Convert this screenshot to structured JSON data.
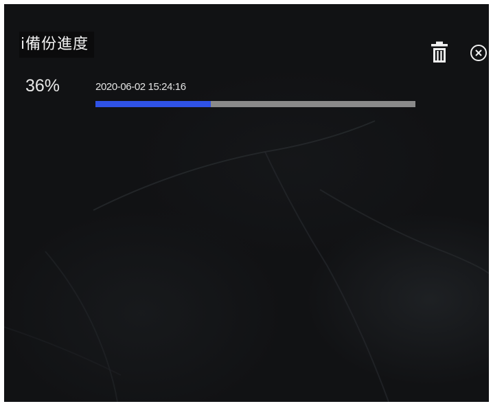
{
  "panel": {
    "title_glyph": "ⅰ",
    "title": "備份進度",
    "percent_label": "36%",
    "timestamp": "2020-06-02 15:24:16",
    "progress_fraction": 0.36
  },
  "icons": {
    "delete": "trash-icon",
    "close": "close-circle-icon"
  },
  "colors": {
    "background": "#111214",
    "progress_fill": "#2f52e6",
    "progress_track": "#8a8a8a",
    "text": "#eeeeee"
  }
}
